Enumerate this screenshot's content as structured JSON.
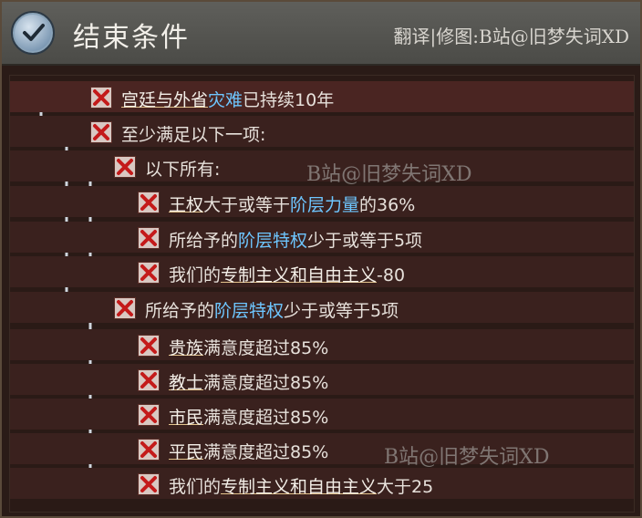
{
  "header": {
    "title": "结束条件",
    "credit": "翻译|修图:B站@旧梦失词XD"
  },
  "watermarks": {
    "wm1": "B站@旧梦失词XD",
    "wm2": "B站@旧梦失词XD"
  },
  "conditions": [
    {
      "parts": [
        {
          "text": "宫廷与外省",
          "style": "u"
        },
        {
          "text": "灾难",
          "style": "b"
        },
        {
          "text": "已持续10年",
          "style": ""
        }
      ]
    },
    {
      "parts": [
        {
          "text": "至少满足以下一项:",
          "style": ""
        }
      ]
    },
    {
      "parts": [
        {
          "text": "以下所有:",
          "style": ""
        }
      ]
    },
    {
      "parts": [
        {
          "text": "王权",
          "style": "u"
        },
        {
          "text": "大于或等于",
          "style": ""
        },
        {
          "text": "阶层力量",
          "style": "b"
        },
        {
          "text": "的36%",
          "style": ""
        }
      ]
    },
    {
      "parts": [
        {
          "text": "所给予的",
          "style": ""
        },
        {
          "text": "阶层特权",
          "style": "b"
        },
        {
          "text": "少于或等于5项",
          "style": ""
        }
      ]
    },
    {
      "parts": [
        {
          "text": "我们的",
          "style": ""
        },
        {
          "text": "专制主义和自由主义",
          "style": "u"
        },
        {
          "text": "-80",
          "style": ""
        }
      ]
    },
    {
      "parts": [
        {
          "text": "所给予的",
          "style": ""
        },
        {
          "text": "阶层特权",
          "style": "b"
        },
        {
          "text": "少于或等于5项",
          "style": ""
        }
      ]
    },
    {
      "parts": [
        {
          "text": "贵族",
          "style": "u"
        },
        {
          "text": "满意度超过85%",
          "style": ""
        }
      ]
    },
    {
      "parts": [
        {
          "text": "教士",
          "style": "u"
        },
        {
          "text": "满意度超过85%",
          "style": ""
        }
      ]
    },
    {
      "parts": [
        {
          "text": "市民",
          "style": "u"
        },
        {
          "text": "满意度超过85%",
          "style": ""
        }
      ]
    },
    {
      "parts": [
        {
          "text": "平民",
          "style": "u"
        },
        {
          "text": "满意度超过85%",
          "style": ""
        }
      ]
    },
    {
      "parts": [
        {
          "text": "我们的",
          "style": ""
        },
        {
          "text": "专制主义和自由主义",
          "style": "u"
        },
        {
          "text": "大于25",
          "style": ""
        }
      ]
    }
  ],
  "icons": {
    "header": "check-icon",
    "condition": "failed-x-icon"
  },
  "colors": {
    "link": "#6ec6ff",
    "underline": "#e5c58e"
  }
}
